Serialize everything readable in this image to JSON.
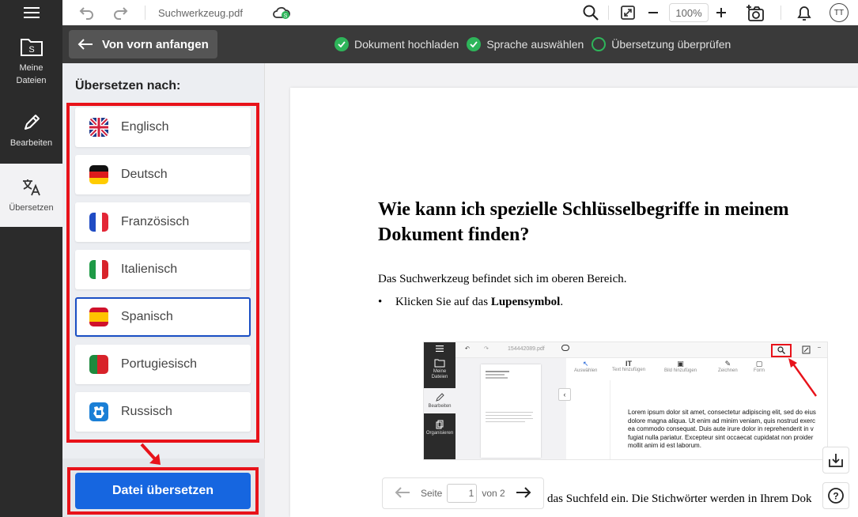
{
  "rail": {
    "items": [
      {
        "label": "Meine\nDateien"
      },
      {
        "label": "Bearbeiten"
      },
      {
        "label": "Übersetzen"
      }
    ]
  },
  "topbar": {
    "filename": "Suchwerkzeug.pdf",
    "zoom": "100%",
    "avatar": "TT"
  },
  "stepbar": {
    "restart_label": "Von vorn anfangen",
    "steps": [
      "Dokument hochladen",
      "Sprache auswählen",
      "Übersetzung überprüfen"
    ]
  },
  "panel": {
    "title": "Übersetzen nach:",
    "languages": [
      "Englisch",
      "Deutsch",
      "Französisch",
      "Italienisch",
      "Spanisch",
      "Portugiesisch",
      "Russisch"
    ],
    "selected": "Spanisch",
    "translate_button": "Datei übersetzen"
  },
  "document": {
    "heading": "Wie kann ich spezielle Schlüsselbegriffe in meinem Dokument finden?",
    "paragraph": "Das Suchwerkzeug befindet sich im oberen Bereich.",
    "bullet_prefix": "Klicken Sie auf das ",
    "bullet_bold": "Lupensymbol",
    "bullet_suffix": ".",
    "bottom_text": "das Suchfeld ein. Die Stichwörter werden in Ihrem Dok",
    "embedded": {
      "filename": "154442089.pdf",
      "rail_items": [
        "Meine Dateien",
        "Bearbeiten",
        "Organisieren"
      ],
      "tools": [
        "Auswählen",
        "Text hinzufügen",
        "Bild hinzufügen",
        "Zeichnen",
        "Form"
      ],
      "lorem": [
        "Lorem ipsum dolor sit amet, consectetur adipiscing elit, sed do eius",
        "dolore magna aliqua. Ut enim ad minim veniam, quis nostrud exerc",
        "ea commodo consequat. Duis aute irure dolor in reprehenderit in v",
        "fugiat nulla pariatur. Excepteur sint occaecat cupidatat non proider",
        "mollit anim id est laborum."
      ]
    }
  },
  "pagenav": {
    "label": "Seite",
    "current": "1",
    "total": "von 2"
  },
  "colors": {
    "accent": "#1666e0",
    "highlight": "#e8121a",
    "success": "#2eb55a"
  }
}
